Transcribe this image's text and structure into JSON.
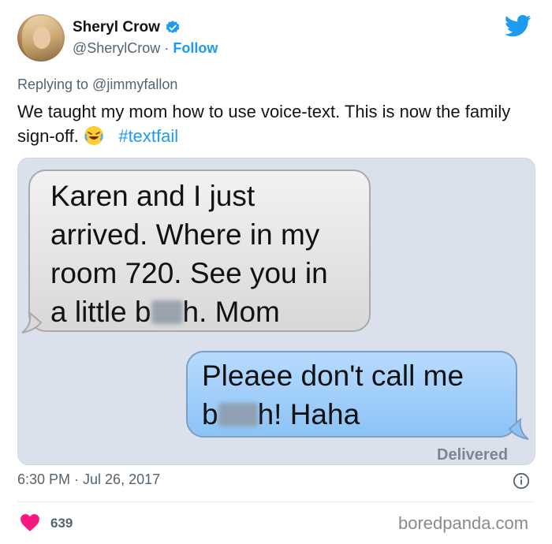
{
  "tweet": {
    "author_name": "Sheryl Crow",
    "handle": "@SherylCrow",
    "separator": "·",
    "follow_label": "Follow",
    "replying_to": "Replying to @jimmyfallon",
    "text_part1": "We taught my mom how to use voice-text. This is now the family sign-off.",
    "emoji": "😂",
    "hashtag": "#textfail",
    "timestamp": "6:30 PM · Jul 26, 2017",
    "likes": "639"
  },
  "media": {
    "incoming": {
      "line1": "Karen and I just",
      "line2": "arrived. Where in my",
      "line3": "room 720. See you in",
      "line4_a": "a little b",
      "line4_b": "h. Mom"
    },
    "outgoing": {
      "line1": "Pleaee don't call me",
      "line2_a": "b",
      "line2_b": "h! Haha"
    },
    "status": "Delivered"
  },
  "watermark": "boredpanda.com",
  "colors": {
    "accent": "#1d9bf0",
    "like": "#f91880",
    "incoming_bubble": "#e3e3e3",
    "outgoing_bubble": "#a6d0fb"
  },
  "icons": [
    "verified-badge-icon",
    "twitter-bird-icon",
    "info-icon",
    "heart-icon",
    "laughing-emoji-icon"
  ]
}
